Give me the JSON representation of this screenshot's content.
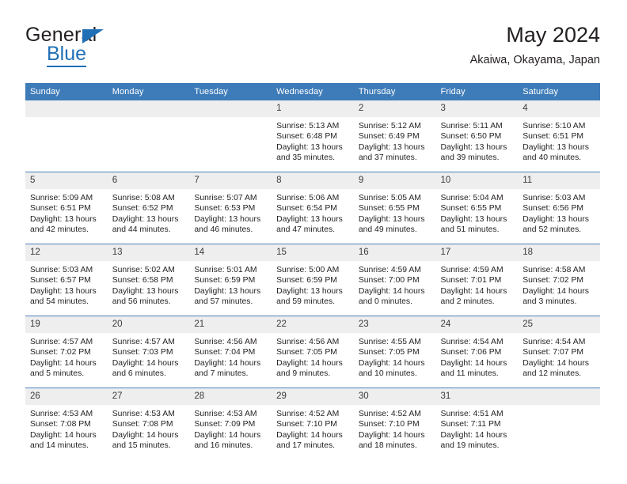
{
  "brand": {
    "word1": "General",
    "word2": "Blue",
    "triangle_color": "#1f6fb7",
    "text_color": "#231f20"
  },
  "header": {
    "title": "May 2024",
    "subtitle": "Akaiwa, Okayama, Japan"
  },
  "theme": {
    "header_blue": "#3e7cb9",
    "row_rule_blue": "#4a81bb",
    "daynum_band": "#eeeeee"
  },
  "weekdays": [
    "Sunday",
    "Monday",
    "Tuesday",
    "Wednesday",
    "Thursday",
    "Friday",
    "Saturday"
  ],
  "weeks": [
    [
      {
        "day": ""
      },
      {
        "day": ""
      },
      {
        "day": ""
      },
      {
        "day": "1",
        "sunrise": "Sunrise: 5:13 AM",
        "sunset": "Sunset: 6:48 PM",
        "daylight_1": "Daylight: 13 hours",
        "daylight_2": "and 35 minutes."
      },
      {
        "day": "2",
        "sunrise": "Sunrise: 5:12 AM",
        "sunset": "Sunset: 6:49 PM",
        "daylight_1": "Daylight: 13 hours",
        "daylight_2": "and 37 minutes."
      },
      {
        "day": "3",
        "sunrise": "Sunrise: 5:11 AM",
        "sunset": "Sunset: 6:50 PM",
        "daylight_1": "Daylight: 13 hours",
        "daylight_2": "and 39 minutes."
      },
      {
        "day": "4",
        "sunrise": "Sunrise: 5:10 AM",
        "sunset": "Sunset: 6:51 PM",
        "daylight_1": "Daylight: 13 hours",
        "daylight_2": "and 40 minutes."
      }
    ],
    [
      {
        "day": "5",
        "sunrise": "Sunrise: 5:09 AM",
        "sunset": "Sunset: 6:51 PM",
        "daylight_1": "Daylight: 13 hours",
        "daylight_2": "and 42 minutes."
      },
      {
        "day": "6",
        "sunrise": "Sunrise: 5:08 AM",
        "sunset": "Sunset: 6:52 PM",
        "daylight_1": "Daylight: 13 hours",
        "daylight_2": "and 44 minutes."
      },
      {
        "day": "7",
        "sunrise": "Sunrise: 5:07 AM",
        "sunset": "Sunset: 6:53 PM",
        "daylight_1": "Daylight: 13 hours",
        "daylight_2": "and 46 minutes."
      },
      {
        "day": "8",
        "sunrise": "Sunrise: 5:06 AM",
        "sunset": "Sunset: 6:54 PM",
        "daylight_1": "Daylight: 13 hours",
        "daylight_2": "and 47 minutes."
      },
      {
        "day": "9",
        "sunrise": "Sunrise: 5:05 AM",
        "sunset": "Sunset: 6:55 PM",
        "daylight_1": "Daylight: 13 hours",
        "daylight_2": "and 49 minutes."
      },
      {
        "day": "10",
        "sunrise": "Sunrise: 5:04 AM",
        "sunset": "Sunset: 6:55 PM",
        "daylight_1": "Daylight: 13 hours",
        "daylight_2": "and 51 minutes."
      },
      {
        "day": "11",
        "sunrise": "Sunrise: 5:03 AM",
        "sunset": "Sunset: 6:56 PM",
        "daylight_1": "Daylight: 13 hours",
        "daylight_2": "and 52 minutes."
      }
    ],
    [
      {
        "day": "12",
        "sunrise": "Sunrise: 5:03 AM",
        "sunset": "Sunset: 6:57 PM",
        "daylight_1": "Daylight: 13 hours",
        "daylight_2": "and 54 minutes."
      },
      {
        "day": "13",
        "sunrise": "Sunrise: 5:02 AM",
        "sunset": "Sunset: 6:58 PM",
        "daylight_1": "Daylight: 13 hours",
        "daylight_2": "and 56 minutes."
      },
      {
        "day": "14",
        "sunrise": "Sunrise: 5:01 AM",
        "sunset": "Sunset: 6:59 PM",
        "daylight_1": "Daylight: 13 hours",
        "daylight_2": "and 57 minutes."
      },
      {
        "day": "15",
        "sunrise": "Sunrise: 5:00 AM",
        "sunset": "Sunset: 6:59 PM",
        "daylight_1": "Daylight: 13 hours",
        "daylight_2": "and 59 minutes."
      },
      {
        "day": "16",
        "sunrise": "Sunrise: 4:59 AM",
        "sunset": "Sunset: 7:00 PM",
        "daylight_1": "Daylight: 14 hours",
        "daylight_2": "and 0 minutes."
      },
      {
        "day": "17",
        "sunrise": "Sunrise: 4:59 AM",
        "sunset": "Sunset: 7:01 PM",
        "daylight_1": "Daylight: 14 hours",
        "daylight_2": "and 2 minutes."
      },
      {
        "day": "18",
        "sunrise": "Sunrise: 4:58 AM",
        "sunset": "Sunset: 7:02 PM",
        "daylight_1": "Daylight: 14 hours",
        "daylight_2": "and 3 minutes."
      }
    ],
    [
      {
        "day": "19",
        "sunrise": "Sunrise: 4:57 AM",
        "sunset": "Sunset: 7:02 PM",
        "daylight_1": "Daylight: 14 hours",
        "daylight_2": "and 5 minutes."
      },
      {
        "day": "20",
        "sunrise": "Sunrise: 4:57 AM",
        "sunset": "Sunset: 7:03 PM",
        "daylight_1": "Daylight: 14 hours",
        "daylight_2": "and 6 minutes."
      },
      {
        "day": "21",
        "sunrise": "Sunrise: 4:56 AM",
        "sunset": "Sunset: 7:04 PM",
        "daylight_1": "Daylight: 14 hours",
        "daylight_2": "and 7 minutes."
      },
      {
        "day": "22",
        "sunrise": "Sunrise: 4:56 AM",
        "sunset": "Sunset: 7:05 PM",
        "daylight_1": "Daylight: 14 hours",
        "daylight_2": "and 9 minutes."
      },
      {
        "day": "23",
        "sunrise": "Sunrise: 4:55 AM",
        "sunset": "Sunset: 7:05 PM",
        "daylight_1": "Daylight: 14 hours",
        "daylight_2": "and 10 minutes."
      },
      {
        "day": "24",
        "sunrise": "Sunrise: 4:54 AM",
        "sunset": "Sunset: 7:06 PM",
        "daylight_1": "Daylight: 14 hours",
        "daylight_2": "and 11 minutes."
      },
      {
        "day": "25",
        "sunrise": "Sunrise: 4:54 AM",
        "sunset": "Sunset: 7:07 PM",
        "daylight_1": "Daylight: 14 hours",
        "daylight_2": "and 12 minutes."
      }
    ],
    [
      {
        "day": "26",
        "sunrise": "Sunrise: 4:53 AM",
        "sunset": "Sunset: 7:08 PM",
        "daylight_1": "Daylight: 14 hours",
        "daylight_2": "and 14 minutes."
      },
      {
        "day": "27",
        "sunrise": "Sunrise: 4:53 AM",
        "sunset": "Sunset: 7:08 PM",
        "daylight_1": "Daylight: 14 hours",
        "daylight_2": "and 15 minutes."
      },
      {
        "day": "28",
        "sunrise": "Sunrise: 4:53 AM",
        "sunset": "Sunset: 7:09 PM",
        "daylight_1": "Daylight: 14 hours",
        "daylight_2": "and 16 minutes."
      },
      {
        "day": "29",
        "sunrise": "Sunrise: 4:52 AM",
        "sunset": "Sunset: 7:10 PM",
        "daylight_1": "Daylight: 14 hours",
        "daylight_2": "and 17 minutes."
      },
      {
        "day": "30",
        "sunrise": "Sunrise: 4:52 AM",
        "sunset": "Sunset: 7:10 PM",
        "daylight_1": "Daylight: 14 hours",
        "daylight_2": "and 18 minutes."
      },
      {
        "day": "31",
        "sunrise": "Sunrise: 4:51 AM",
        "sunset": "Sunset: 7:11 PM",
        "daylight_1": "Daylight: 14 hours",
        "daylight_2": "and 19 minutes."
      },
      {
        "day": ""
      }
    ]
  ]
}
